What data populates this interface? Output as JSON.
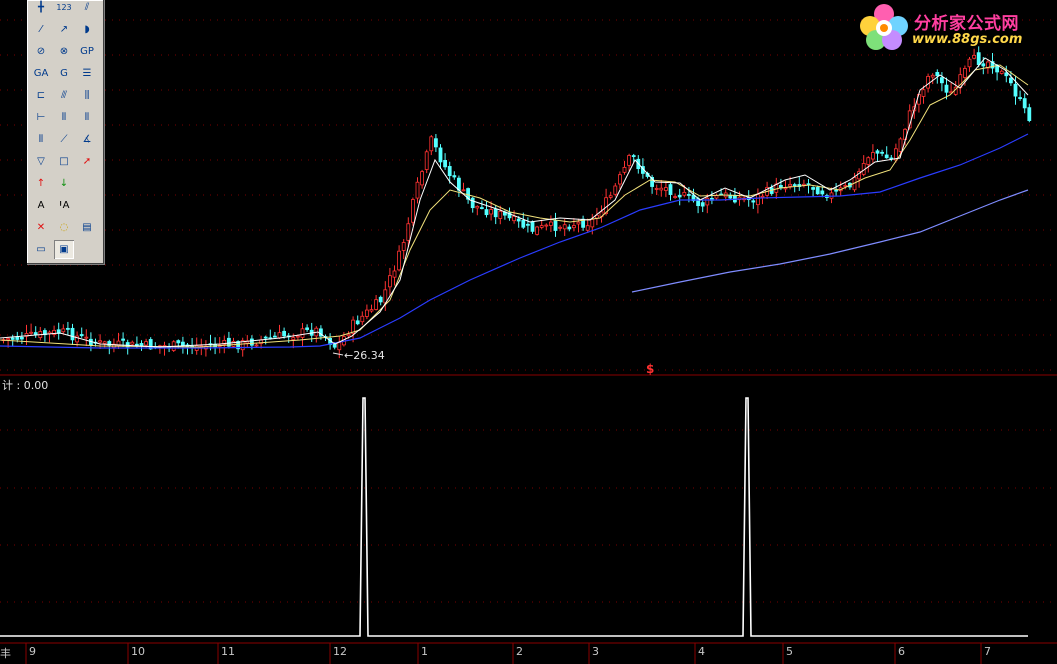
{
  "logo": {
    "text": "分析家公式网",
    "url": "www.88gs.com",
    "icon": "flower-icon"
  },
  "indicator": {
    "label": "计 : 0.00"
  },
  "chart": {
    "low_price_label": "26.34",
    "signal_marker": "$"
  },
  "time_axis": {
    "corner": "丰",
    "months": [
      "9",
      "10",
      "11",
      "12",
      "1",
      "2",
      "3",
      "4",
      "5",
      "6",
      "7"
    ]
  },
  "drawing_toolbar": {
    "tools": [
      "vertical-line-icon",
      "number-123-icon",
      "parallel-lines-icon",
      "line-segment-icon",
      "ray-icon",
      "arc-icon",
      "circle-icon",
      "circle-cross-icon",
      "gp-icon",
      "ga-icon",
      "g-icon",
      "text-lines-icon",
      "bracket-lines-icon",
      "fan-lines-icon",
      "channel-icon",
      "h-lines-icon",
      "grid-lines-icon",
      "multi-lines-icon",
      "bars-icon",
      "slant-fan-icon",
      "angle-fan-icon",
      "triangle-icon",
      "rectangle-icon",
      "red-arrow-line-icon",
      "up-arrow-icon",
      "down-arrow-icon",
      "text-a-icon",
      "text-a-bracket-icon",
      "delete-x-icon",
      "highlight-icon",
      "list-icon",
      "ruler-icon",
      "picture-icon"
    ],
    "colors": {
      "face": "#d4d0c8",
      "icon": "#003a8c"
    }
  },
  "colors": {
    "background": "#000000",
    "candle_up": "#ff3232",
    "candle_down": "#54ffff",
    "ma_short": "#ffffff",
    "ma_mid": "#f3e37c",
    "ma_long": "#2a3cff",
    "ma_extra": "#7f8cff",
    "grid": "#7a0000",
    "indicator_line": "#ffffff"
  }
}
